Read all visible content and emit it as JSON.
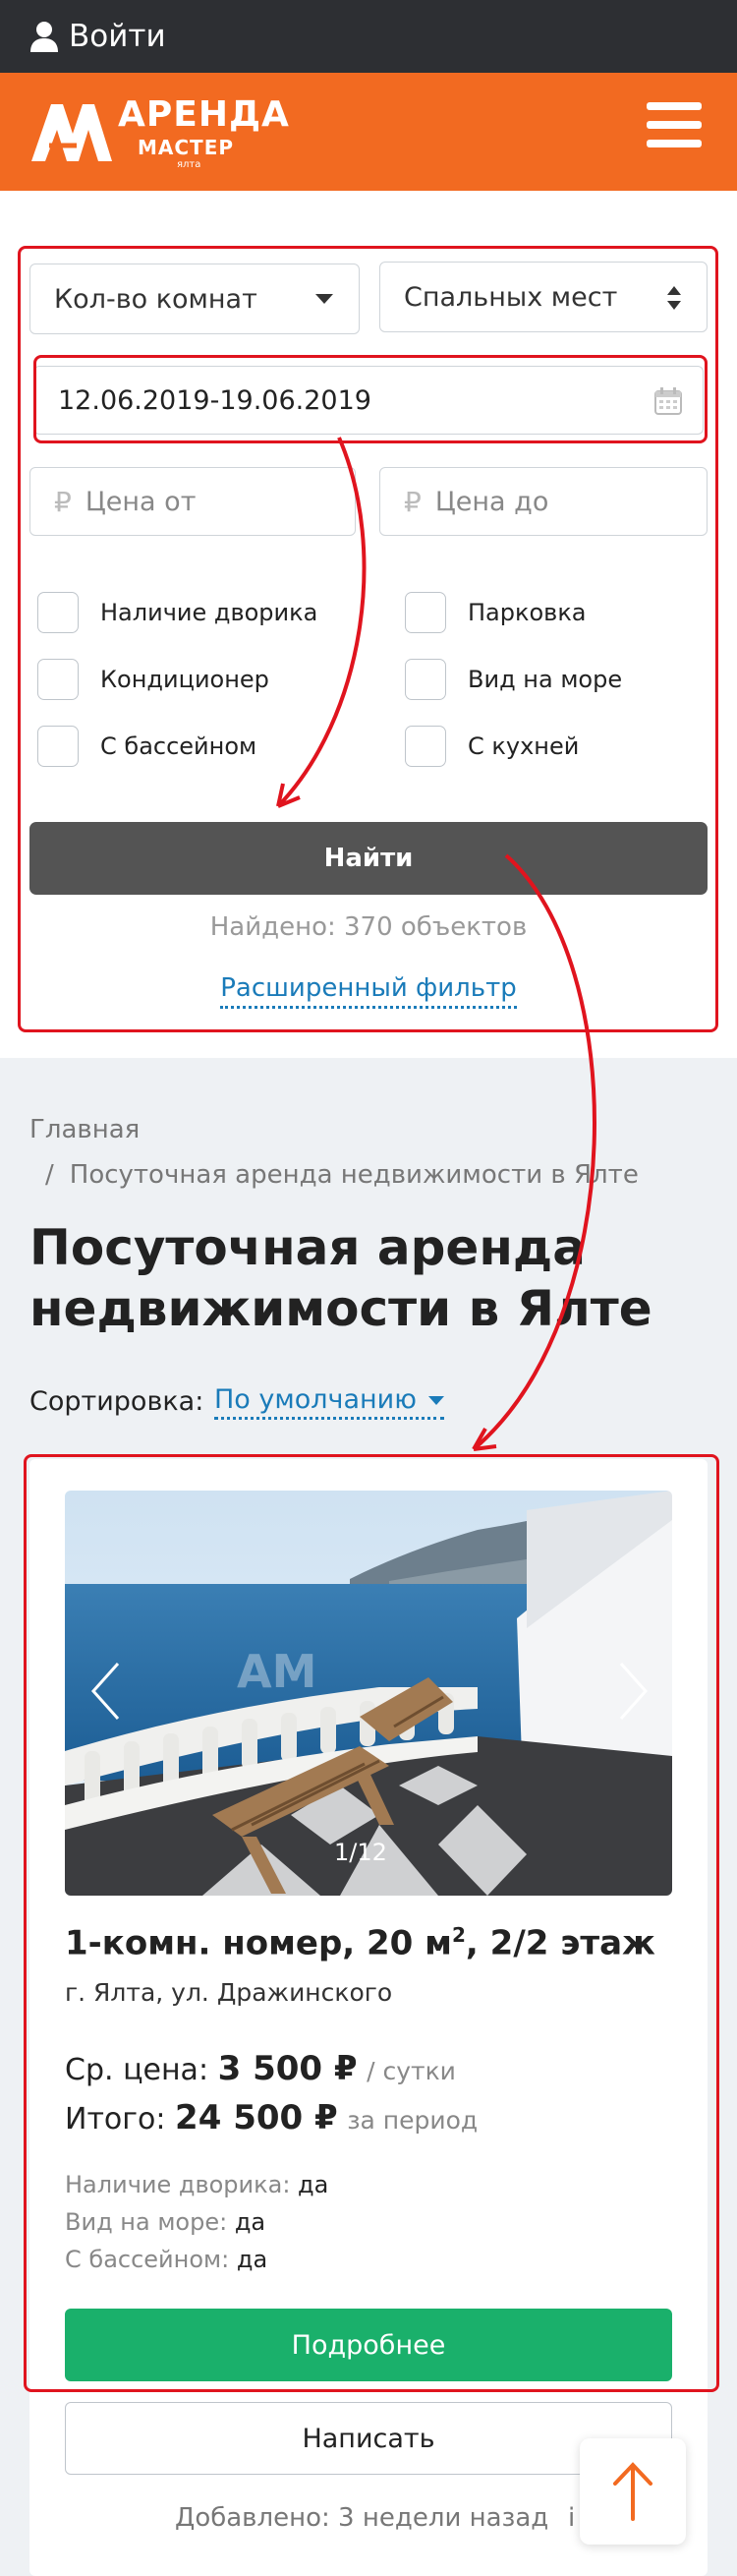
{
  "topbar": {
    "login": "Войти",
    "icon": "user-icon"
  },
  "logo": {
    "line1": "АРЕНДА",
    "line2": "МАСТЕР",
    "line3": "ялта"
  },
  "filter": {
    "rooms_select": "Кол-во комнат",
    "beds_select": "Спальных мест",
    "dates": "12.06.2019-19.06.2019",
    "price_from_placeholder": "Цена от",
    "price_to_placeholder": "Цена до",
    "currency_symbol": "₽",
    "checkboxes": [
      "Наличие дворика",
      "Парковка",
      "Кондиционер",
      "Вид на море",
      "С бассейном",
      "С кухней"
    ],
    "find_button": "Найти",
    "found": "Найдено:  370 объектов",
    "advanced": "Расширенный фильтр"
  },
  "breadcrumb": {
    "home": "Главная",
    "separator": "/",
    "current": "Посуточная аренда недвижимости в Ялте"
  },
  "page_title": "Посуточная аренда недвижимости в Ялте",
  "sort": {
    "label": "Сортировка:",
    "value": "По умолчанию"
  },
  "listing": {
    "photo_counter": "1/12",
    "title": "1-комн. номер, 20 м",
    "title_sup": "2",
    "title_floor": ", 2/2 этаж",
    "address": "г. Ялта, ул. Дражинского",
    "avg_price_label": "Ср. цена:",
    "avg_price": "3 500 ₽",
    "avg_price_unit": "/ сутки",
    "total_label": "Итого:",
    "total_price": "24 500 ₽",
    "total_unit": "за период",
    "features": [
      {
        "name": "Наличие дворика:",
        "value": "да"
      },
      {
        "name": "Вид на море:",
        "value": "да"
      },
      {
        "name": "С бассейном:",
        "value": "да"
      }
    ],
    "details_button": "Подробнее",
    "write_button": "Написать",
    "added": "Добавлено: 3 недели назад",
    "added_extra": "i"
  },
  "colors": {
    "brand_orange": "#f26a21",
    "annotation_red": "#e0141e",
    "link_blue": "#1a7bb9",
    "success_green": "#1ab06b",
    "dark": "#2d2f33"
  }
}
